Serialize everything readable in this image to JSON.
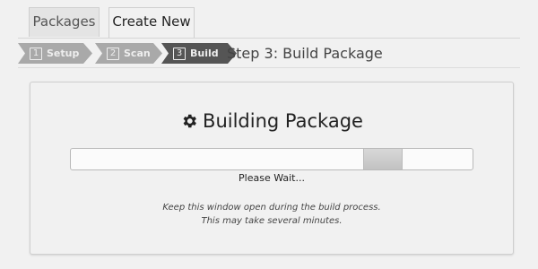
{
  "tabs": [
    {
      "label": "Packages",
      "active": false
    },
    {
      "label": "Create New",
      "active": true
    }
  ],
  "steps": [
    {
      "num": "1",
      "label": "Setup"
    },
    {
      "num": "2",
      "label": "Scan"
    },
    {
      "num": "3",
      "label": "Build",
      "current": true
    }
  ],
  "step_title": "Step 3: Build Package",
  "panel": {
    "heading": "Building Package",
    "heading_icon": "gear-icon",
    "progress_status": "indeterminate",
    "wait_text": "Please Wait...",
    "note_line1": "Keep this window open during the build process.",
    "note_line2": "This may take several minutes."
  },
  "colors": {
    "step_inactive": "#a9a9a9",
    "step_current": "#555555"
  }
}
